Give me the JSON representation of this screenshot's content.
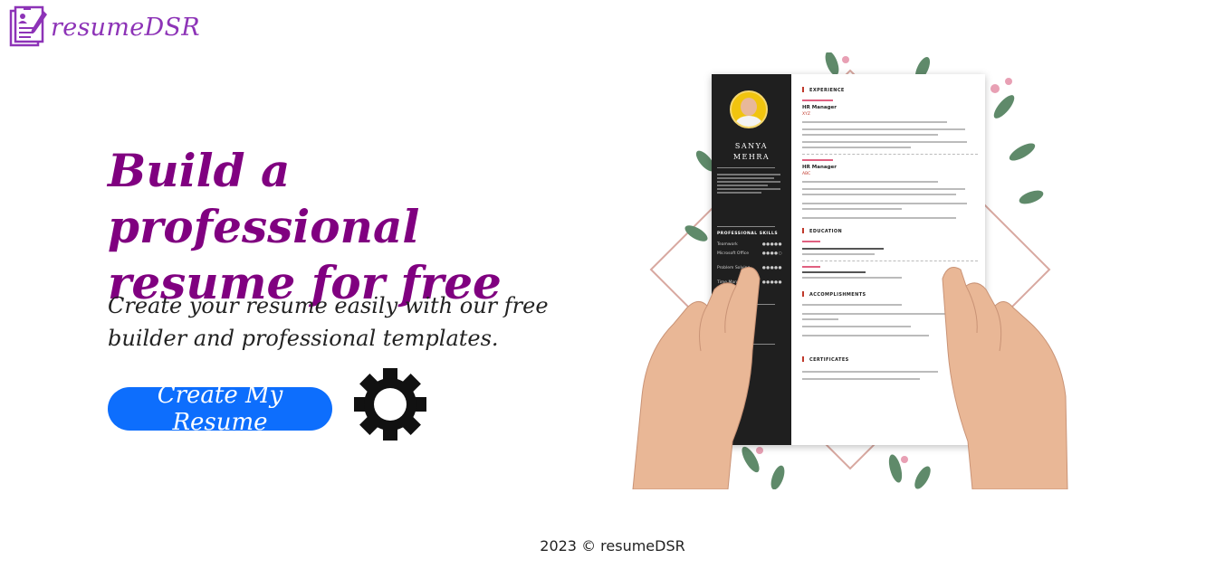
{
  "brand": {
    "name": "resumeDSR",
    "logo_icon": "resume-pen-icon",
    "color": "#8d33b7"
  },
  "hero": {
    "title": "Build a professional resume for free",
    "subtitle": "Create your resume easily with our free builder and professional templates.",
    "cta_label": "Create My Resume",
    "cta_color": "#0d6efd",
    "title_color": "#800080"
  },
  "decor": {
    "gear_icon": "gear-icon"
  },
  "resume_preview": {
    "name_first": "SANYA",
    "name_last": "MEHRA",
    "skills_heading": "PROFESSIONAL SKILLS",
    "sections": [
      "EXPERIENCE",
      "EDUCATION",
      "ACCOMPLISHMENTS",
      "CERTIFICATES"
    ],
    "job1_title": "HR Manager",
    "job1_company": "XYZ",
    "job2_title": "HR Manager",
    "job2_company": "ABC",
    "skills": [
      {
        "label": "Teamwork",
        "level": 5
      },
      {
        "label": "Microsoft Office",
        "level": 4
      },
      {
        "label": "Problem Solving",
        "level": 5
      },
      {
        "label": "Time Management",
        "level": 5
      }
    ]
  },
  "footer": {
    "text": "2023 © resumeDSR"
  }
}
